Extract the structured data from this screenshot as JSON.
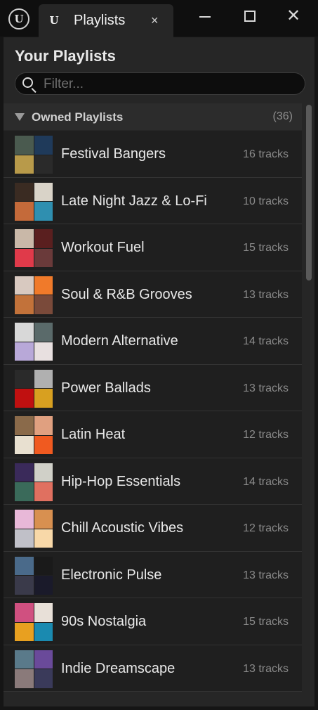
{
  "window": {
    "logo_icon": "unreal-engine-logo-icon",
    "tab": {
      "title": "Playlists",
      "close_glyph": "×",
      "icon": "unreal-engine-icon"
    },
    "controls": {
      "close_glyph": "✕"
    }
  },
  "panel": {
    "heading": "Your Playlists",
    "filter": {
      "placeholder": "Filter...",
      "value": ""
    },
    "section": {
      "title": "Owned Playlists",
      "count": "(36)"
    }
  },
  "playlists": [
    {
      "name": "Festival Bangers",
      "tracks": "16 tracks",
      "cover_colors": [
        "#4a5a4f",
        "#1f3a5a",
        "#b89a4a",
        "#2a2a2a"
      ]
    },
    {
      "name": "Late Night Jazz & Lo-Fi",
      "tracks": "10 tracks",
      "cover_colors": [
        "#3a2b22",
        "#d9d3c8",
        "#c46a3a",
        "#2f8fb0"
      ]
    },
    {
      "name": "Workout Fuel",
      "tracks": "15 tracks",
      "cover_colors": [
        "#c9b8a8",
        "#5a1f1f",
        "#e03a4a",
        "#6a3a3a"
      ]
    },
    {
      "name": "Soul & R&B Grooves",
      "tracks": "13 tracks",
      "cover_colors": [
        "#d8c9c0",
        "#f07a2a",
        "#c2723a",
        "#7a4a3a"
      ]
    },
    {
      "name": "Modern Alternative",
      "tracks": "14 tracks",
      "cover_colors": [
        "#d8d8d8",
        "#5a6a6a",
        "#b8a8d8",
        "#e8e0e0"
      ]
    },
    {
      "name": "Power Ballads",
      "tracks": "13 tracks",
      "cover_colors": [
        "#2a2a2a",
        "#b0b0b0",
        "#c01010",
        "#d8a020"
      ]
    },
    {
      "name": "Latin Heat",
      "tracks": "12 tracks",
      "cover_colors": [
        "#8a6a4a",
        "#e0a080",
        "#e8e0d0",
        "#f05a20"
      ]
    },
    {
      "name": "Hip-Hop Essentials",
      "tracks": "14 tracks",
      "cover_colors": [
        "#3a2a5a",
        "#d0d0c8",
        "#3a6a5a",
        "#e07060"
      ]
    },
    {
      "name": "Chill Acoustic Vibes",
      "tracks": "12 tracks",
      "cover_colors": [
        "#e8b8d8",
        "#d89050",
        "#c0c0c8",
        "#f8d8a8"
      ]
    },
    {
      "name": "Electronic Pulse",
      "tracks": "13 tracks",
      "cover_colors": [
        "#4a6a8a",
        "#1a1a1a",
        "#3a3a4a",
        "#1a1a2a"
      ]
    },
    {
      "name": "90s Nostalgia",
      "tracks": "15 tracks",
      "cover_colors": [
        "#d05080",
        "#e8e0d8",
        "#e8a020",
        "#1a8ab0"
      ]
    },
    {
      "name": "Indie Dreamscape",
      "tracks": "13 tracks",
      "cover_colors": [
        "#5a7a8a",
        "#6a4a9a",
        "#8a7a7a",
        "#3a3a5a"
      ]
    }
  ]
}
